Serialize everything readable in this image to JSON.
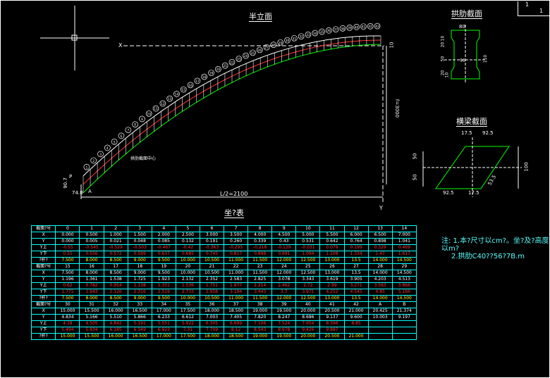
{
  "titles": {
    "elevation": "半立面",
    "rib_section": "拱肋截面",
    "strut_section": "横梁截面",
    "table": "坐?表"
  },
  "sheet": {
    "num": "1",
    "den": "1"
  },
  "labels": {
    "x_axis": "X",
    "y_axis": "Y",
    "span": "L/2=2100",
    "rise": "f=3000",
    "arch_foot": "A",
    "top_dim": "10",
    "left_dim1": "90.7",
    "left_dim2": "74.8",
    "left_p": "P",
    "center_tag": "拱肋截面中心"
  },
  "rib_dims": {
    "width": "80",
    "h1": "10",
    "h2": "20",
    "h3": "50",
    "h4": "110",
    "w2": "50",
    "h5": "20",
    "h6": "10"
  },
  "strut_dims": {
    "top": "92.5",
    "top2": "17.5",
    "bottom": "92.5",
    "bottom2": "17.5",
    "left1": "50",
    "left2": "50",
    "right": "100",
    "slant": "53.5"
  },
  "nodes": [
    "1",
    "2",
    "3",
    "4",
    "5",
    "6",
    "7",
    "8",
    "9",
    "10",
    "11",
    "12",
    "13",
    "14",
    "15",
    "16",
    "17",
    "18",
    "19",
    "20",
    "21",
    "22",
    "23",
    "24",
    "25",
    "26",
    "27",
    "28",
    "29",
    "30",
    "31",
    "32",
    "33",
    "34",
    "35",
    "36",
    "37",
    "38",
    "39",
    "40",
    "41",
    "42",
    "43"
  ],
  "note": {
    "line1": "注: 1.本?尺寸以cm?。坐?及?高度以m?",
    "line2": "2.拱肋C40??56?7B.m"
  },
  "table": {
    "blocks": [
      {
        "rows": [
          {
            "h": "截面?号",
            "cells": [
              "0",
              "1",
              "2",
              "3",
              "4",
              "5",
              "6",
              "7",
              "8",
              "9",
              "10",
              "11",
              "12",
              "13",
              "14"
            ],
            "c": "h"
          },
          {
            "h": "X",
            "cells": [
              "0.000",
              "0.500",
              "1.000",
              "1.500",
              "2.000",
              "2.500",
              "3.000",
              "3.500",
              "4.000",
              "4.500",
              "5.000",
              "5.500",
              "6.000",
              "6.500",
              "7.000"
            ],
            "c": "h"
          },
          {
            "h": "Y",
            "cells": [
              "0.000",
              "0.005",
              "0.021",
              "0.048",
              "0.085",
              "0.132",
              "0.191",
              "0.260",
              "0.339",
              "0.43",
              "0.531",
              "0.642",
              "0.764",
              "0.898",
              "1.041"
            ],
            "c": "h"
          },
          {
            "h": "Y上",
            "cells": [
              "-0.55",
              "-0.545",
              "-0.529",
              "-0.503",
              "-0.467",
              "-0.42",
              "-0.363",
              "-0.295",
              "-0.218",
              "-0.129",
              "-0.031",
              "0.079",
              "0.199",
              "0.329",
              "0.469"
            ],
            "c": "r"
          },
          {
            "h": "Y下",
            "cells": [
              "0.55",
              "0.556",
              "0.572",
              "0.599",
              "0.637",
              "0.685",
              "0.745",
              "0.817",
              "0.898",
              "0.991",
              "1.094",
              "1.208",
              "1.334",
              "1.47",
              "1.617"
            ],
            "c": "r"
          },
          {
            "h": "?杆?",
            "cells": [
              "7.500",
              "8.000",
              "8.500",
              "9.000",
              "9.500",
              "10.000",
              "10.500",
              "11.000",
              "11.500",
              "12.000",
              "12.500",
              "13.000",
              "13.5",
              "14.000",
              "14.500"
            ],
            "c": "y"
          }
        ]
      },
      {
        "rows": [
          {
            "h": "截面?号",
            "cells": [
              "15",
              "16",
              "17",
              "18",
              "19",
              "20",
              "21",
              "22",
              "23",
              "24",
              "25",
              "26",
              "27",
              "28",
              "29"
            ],
            "c": "h"
          },
          {
            "h": "X",
            "cells": [
              "7.500",
              "8.000",
              "8.500",
              "9.000",
              "9.500",
              "10.000",
              "10.500",
              "11.000",
              "11.500",
              "12.000",
              "12.500",
              "13.000",
              "13.5",
              "14.000",
              "14.500"
            ],
            "c": "h"
          },
          {
            "h": "Y",
            "cells": [
              "1.196",
              "1.361",
              "1.538",
              "1.725",
              "1.923",
              "2.132",
              "2.352",
              "2.583",
              "2.825",
              "3.078",
              "3.343",
              "3.619",
              "3.905",
              "4.203",
              "4.513"
            ],
            "c": "h"
          },
          {
            "h": "Y上",
            "cells": [
              "0.62",
              "0.782",
              "0.954",
              "1.138",
              "1.331",
              "1.536",
              "1.751",
              "1.977",
              "2.214",
              "2.462",
              "2.72",
              "2.99",
              "3.271",
              "3.563",
              "3.866"
            ],
            "c": "r"
          },
          {
            "h": "Y下",
            "cells": [
              "1.775",
              "1.943",
              "2.126",
              "2.316",
              "2.519",
              "2.733",
              "2.958",
              "3.194",
              "3.443",
              "3.7",
              "3.971",
              "4.252",
              "4.545",
              "4.85",
              "5.166"
            ],
            "c": "r"
          },
          {
            "h": "?杆?",
            "cells": [
              "7.500",
              "8.000",
              "8.500",
              "9.000",
              "9.500",
              "10.000",
              "10.500",
              "11.000",
              "11.500",
              "12.000",
              "12.500",
              "13.000",
              "13.5",
              "14.000",
              "14.500"
            ],
            "c": "y"
          }
        ]
      },
      {
        "rows": [
          {
            "h": "截面?号",
            "cells": [
              "30",
              "31",
              "32",
              "33",
              "34",
              "35",
              "36",
              "37",
              "38",
              "39",
              "40",
              "41",
              "42",
              "A",
              "B"
            ],
            "c": "h"
          },
          {
            "h": "X",
            "cells": [
              "15.000",
              "15.500",
              "16.000",
              "16.500",
              "17.000",
              "17.500",
              "18.000",
              "18.500",
              "19.000",
              "19.500",
              "20.000",
              "20.500",
              "21.000",
              "20.425",
              "21.374"
            ],
            "c": "h"
          },
          {
            "h": "Y",
            "cells": [
              "4.834",
              "5.166",
              "5.510",
              "5.866",
              "6.233",
              "6.612",
              "7.003",
              "7.405",
              "7.820",
              "8.247",
              "8.686",
              "9.137",
              "9.600",
              "10.003",
              "9.197"
            ],
            "c": "h"
          },
          {
            "h": "Y上",
            "cells": [
              "4.18",
              "4.505",
              "4.842",
              "5.191",
              "5.551",
              "5.922",
              "6.305",
              "6.699",
              "7.106",
              "7.524",
              "7.954",
              "8.396",
              "8.85",
              "",
              ""
            ],
            "c": "r"
          },
          {
            "h": "Y下",
            "cells": [
              "5.494",
              "5.834",
              "6.185",
              "6.549",
              "6.923",
              "7.31",
              "7.709",
              "8.12",
              "8.543",
              "8.978",
              "9.426",
              "9.887",
              "",
              "",
              ""
            ],
            "c": "r"
          },
          {
            "h": "?杆?",
            "cells": [
              "15.000",
              "15.500",
              "16.000",
              "16.500",
              "17.000",
              "17.500",
              "18.000",
              "18.500",
              "19.000",
              "19.500",
              "20.000",
              "20.500",
              "21.000",
              "",
              ""
            ],
            "c": "y"
          }
        ]
      }
    ]
  }
}
